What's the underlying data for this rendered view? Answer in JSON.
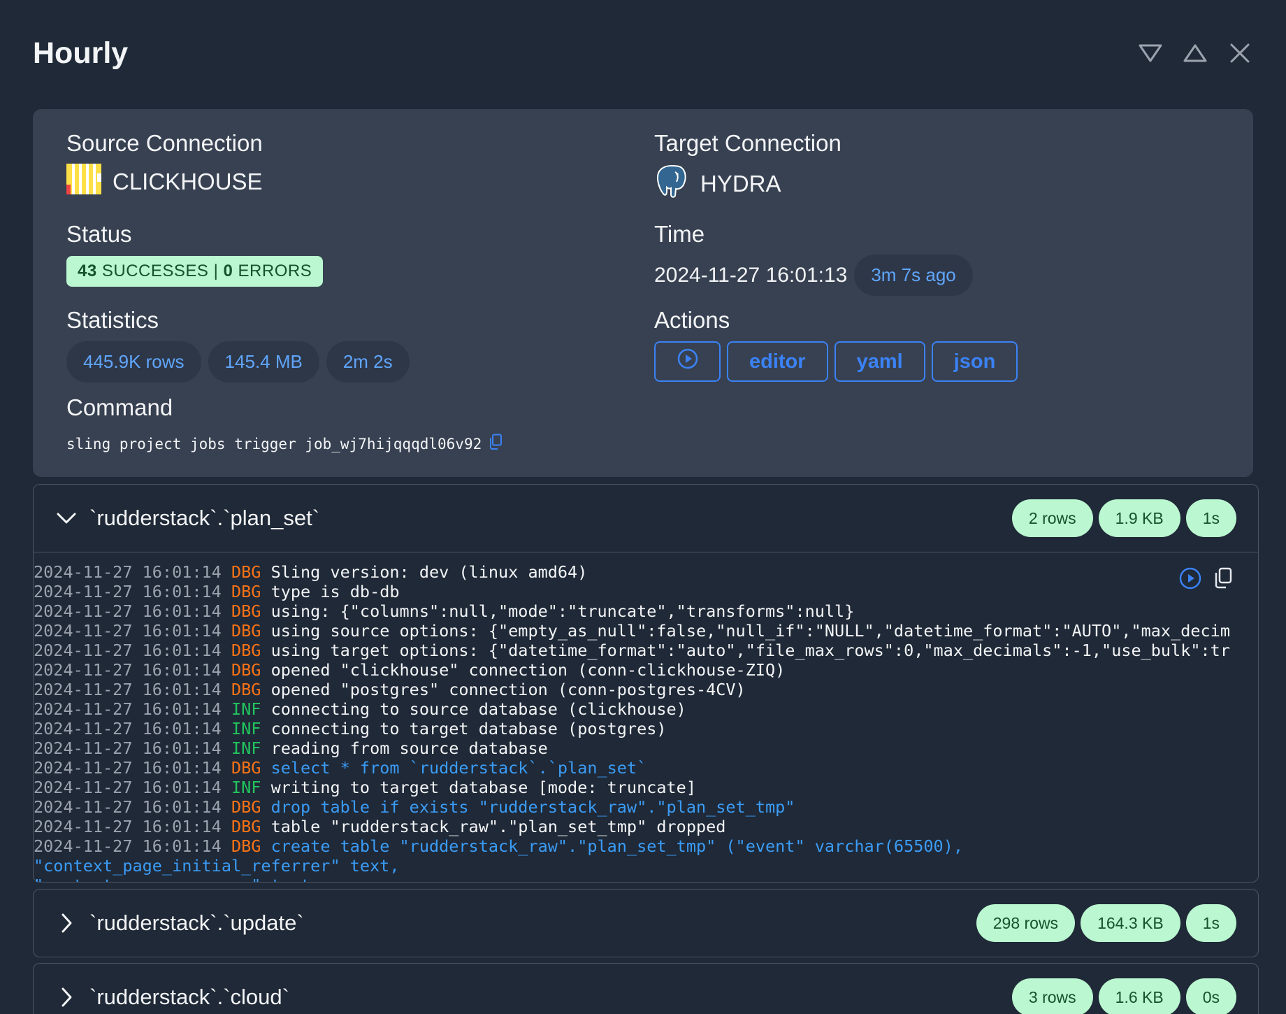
{
  "window": {
    "title": "Hourly"
  },
  "header_icons": [
    "triangle-down-icon",
    "triangle-up-icon",
    "close-icon"
  ],
  "source": {
    "label": "Source Connection",
    "name": "CLICKHOUSE",
    "icon": "clickhouse-logo"
  },
  "target": {
    "label": "Target Connection",
    "name": "HYDRA",
    "icon": "postgres-elephant-logo"
  },
  "status": {
    "label": "Status",
    "successes": "43",
    "successes_label": "SUCCESSES",
    "separator": "|",
    "errors": "0",
    "errors_label": "ERRORS"
  },
  "time": {
    "label": "Time",
    "value": "2024-11-27 16:01:13",
    "ago": "3m 7s ago"
  },
  "statistics": {
    "label": "Statistics",
    "rows": "445.9K rows",
    "size": "145.4 MB",
    "duration": "2m 2s"
  },
  "actions": {
    "label": "Actions",
    "run_icon": "play-circle-icon",
    "editor": "editor",
    "yaml": "yaml",
    "json": "json"
  },
  "command": {
    "label": "Command",
    "text": "sling project jobs trigger job_wj7hijqqqdl06v92",
    "copy_icon": "copy-icon"
  },
  "colors": {
    "background": "#1f2937",
    "card": "#374151",
    "accent": "#3b82f6",
    "success_bg": "#bbf7d0",
    "success_text": "#14532d",
    "dbg": "#f97316",
    "inf": "#22c55e",
    "sql": "#3b9cf6"
  },
  "streams": [
    {
      "name": "`rudderstack`.`plan_set`",
      "expanded": true,
      "rows": "2 rows",
      "size": "1.9 KB",
      "duration": "1s",
      "log": [
        {
          "ts": "2024-11-27 16:01:14",
          "level": "DBG",
          "msg": "Sling version: dev (linux amd64)",
          "sql": false
        },
        {
          "ts": "2024-11-27 16:01:14",
          "level": "DBG",
          "msg": "type is db-db",
          "sql": false
        },
        {
          "ts": "2024-11-27 16:01:14",
          "level": "DBG",
          "msg": "using: {\"columns\":null,\"mode\":\"truncate\",\"transforms\":null}",
          "sql": false
        },
        {
          "ts": "2024-11-27 16:01:14",
          "level": "DBG",
          "msg": "using source options: {\"empty_as_null\":false,\"null_if\":\"NULL\",\"datetime_format\":\"AUTO\",\"max_decim",
          "sql": false
        },
        {
          "ts": "2024-11-27 16:01:14",
          "level": "DBG",
          "msg": "using target options: {\"datetime_format\":\"auto\",\"file_max_rows\":0,\"max_decimals\":-1,\"use_bulk\":tr",
          "sql": false
        },
        {
          "ts": "2024-11-27 16:01:14",
          "level": "DBG",
          "msg": "opened \"clickhouse\" connection (conn-clickhouse-ZIQ)",
          "sql": false
        },
        {
          "ts": "2024-11-27 16:01:14",
          "level": "DBG",
          "msg": "opened \"postgres\" connection (conn-postgres-4CV)",
          "sql": false
        },
        {
          "ts": "2024-11-27 16:01:14",
          "level": "INF",
          "msg": "connecting to source database (clickhouse)",
          "sql": false
        },
        {
          "ts": "2024-11-27 16:01:14",
          "level": "INF",
          "msg": "connecting to target database (postgres)",
          "sql": false
        },
        {
          "ts": "2024-11-27 16:01:14",
          "level": "INF",
          "msg": "reading from source database",
          "sql": false
        },
        {
          "ts": "2024-11-27 16:01:14",
          "level": "DBG",
          "msg": "select * from `rudderstack`.`plan_set`",
          "sql": true
        },
        {
          "ts": "2024-11-27 16:01:14",
          "level": "INF",
          "msg": "writing to target database [mode: truncate]",
          "sql": false
        },
        {
          "ts": "2024-11-27 16:01:14",
          "level": "DBG",
          "msg": "drop table if exists \"rudderstack_raw\".\"plan_set_tmp\"",
          "sql": true
        },
        {
          "ts": "2024-11-27 16:01:14",
          "level": "DBG",
          "msg": "table \"rudderstack_raw\".\"plan_set_tmp\" dropped",
          "sql": false
        },
        {
          "ts": "2024-11-27 16:01:14",
          "level": "DBG",
          "msg": "create table \"rudderstack_raw\".\"plan_set_tmp\" (\"event\" varchar(65500),",
          "sql": true
        },
        {
          "ts": "",
          "level": "",
          "msg": "\"context_page_initial_referrer\" text,",
          "sql": true
        },
        {
          "ts": "",
          "level": "",
          "msg": "\"context_app_namespace\" text,",
          "sql": true
        }
      ]
    },
    {
      "name": "`rudderstack`.`update`",
      "expanded": false,
      "rows": "298 rows",
      "size": "164.3 KB",
      "duration": "1s"
    },
    {
      "name": "`rudderstack`.`cloud`",
      "expanded": false,
      "rows": "3 rows",
      "size": "1.6 KB",
      "duration": "0s"
    }
  ]
}
